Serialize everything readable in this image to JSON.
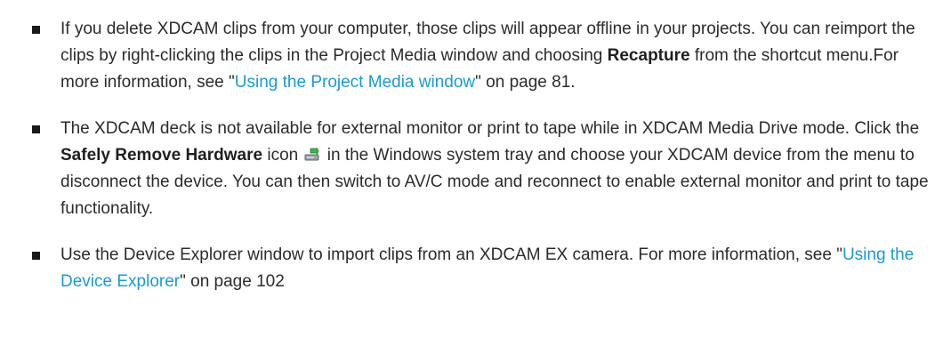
{
  "items": [
    {
      "text_before": "If you delete XDCAM clips from your computer, those clips will appear offline in your projects. You can reimport the clips by right-clicking the clips in the Project Media window and choosing ",
      "strong": "Recapture",
      "text_middle": " from the shortcut menu.For more information, see \"",
      "link": "Using the Project Media window",
      "text_after": "\" on page 81."
    },
    {
      "text_before": "The XDCAM deck is not available for external monitor or print to tape while in XDCAM Media Drive mode. Click the ",
      "strong": "Safely Remove Hardware",
      "text_middle": " icon",
      "icon": "safely-remove-hardware-icon",
      "text_after": " in the Windows system tray and choose your XDCAM device from the menu to disconnect the device. You can then switch to AV/C mode and reconnect to enable external monitor and print to tape functionality."
    },
    {
      "text_before": "Use the Device Explorer window to import clips from an XDCAM EX camera. For more information, see \"",
      "link": "Using the Device Explorer",
      "text_after": "\" on page 102"
    }
  ],
  "colors": {
    "text": "#2b2b2b",
    "link": "#1a9ad6",
    "bullet": "#1a1a1a"
  }
}
